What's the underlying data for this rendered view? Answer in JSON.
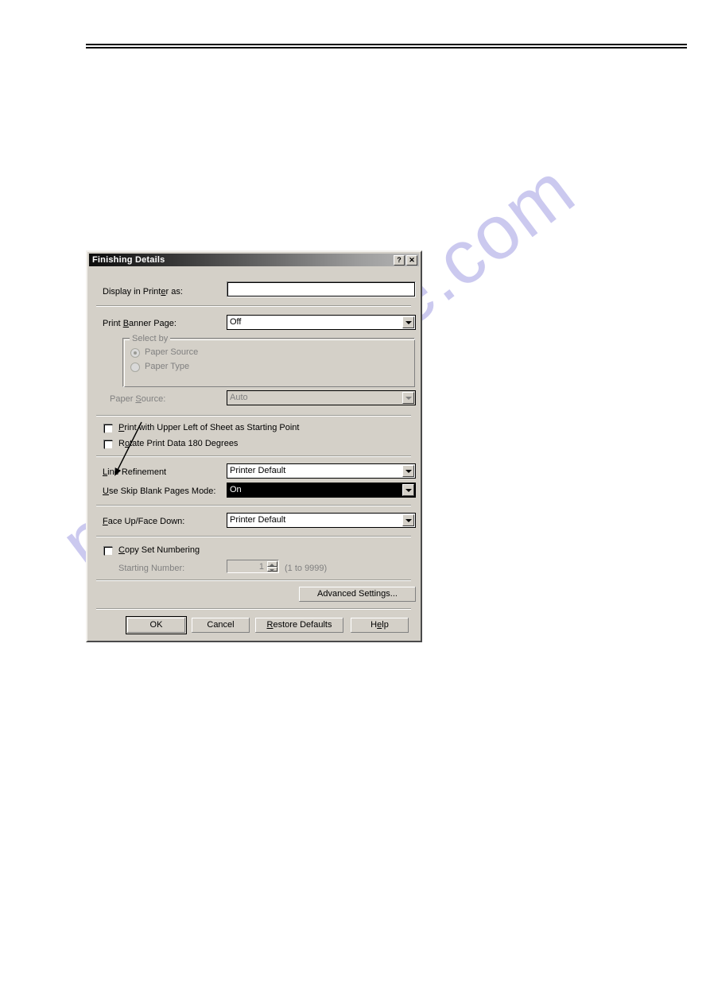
{
  "page": {
    "watermark_text": "manualshive.com",
    "watermark_color": "#c9c7ef",
    "rule_color": "#000000"
  },
  "dialog": {
    "title": "Finishing Details",
    "titlebar_buttons": [
      {
        "name": "help-button",
        "glyph": "?"
      },
      {
        "name": "close-button",
        "glyph": "✕"
      }
    ],
    "fields": {
      "display_in_printer_as": {
        "label": "Display in Printer as:",
        "value": "",
        "enabled": true
      },
      "print_banner_page": {
        "label": "Print Banner Page:",
        "value": "Off",
        "enabled": true
      },
      "select_by": {
        "group_label": "Select by",
        "enabled": false,
        "options": [
          {
            "label": "Paper Source",
            "checked": true
          },
          {
            "label": "Paper Type",
            "checked": false
          }
        ]
      },
      "paper_source": {
        "label": "Paper Source:",
        "value": "Auto",
        "enabled": false
      },
      "print_upper_left": {
        "label": "Print with Upper Left of Sheet as Starting Point",
        "checked": false
      },
      "rotate_180": {
        "label": "Rotate Print Data 180 Degrees",
        "checked": false
      },
      "line_refinement": {
        "label": "Line Refinement",
        "value": "Printer Default",
        "enabled": true
      },
      "skip_blank_pages": {
        "label": "Use Skip Blank Pages Mode:",
        "value": "On",
        "enabled": true,
        "focused": true
      },
      "face_up_face_down": {
        "label": "Face Up/Face Down:",
        "value": "Printer Default",
        "enabled": true
      },
      "copy_set_numbering": {
        "label": "Copy Set Numbering",
        "checked": false
      },
      "starting_number": {
        "label": "Starting Number:",
        "value": "1",
        "range_hint": "(1 to 9999)",
        "enabled": false
      }
    },
    "buttons": {
      "advanced_settings": "Advanced Settings...",
      "ok": "OK",
      "cancel": "Cancel",
      "restore_defaults": "Restore Defaults",
      "help": "Help"
    }
  }
}
